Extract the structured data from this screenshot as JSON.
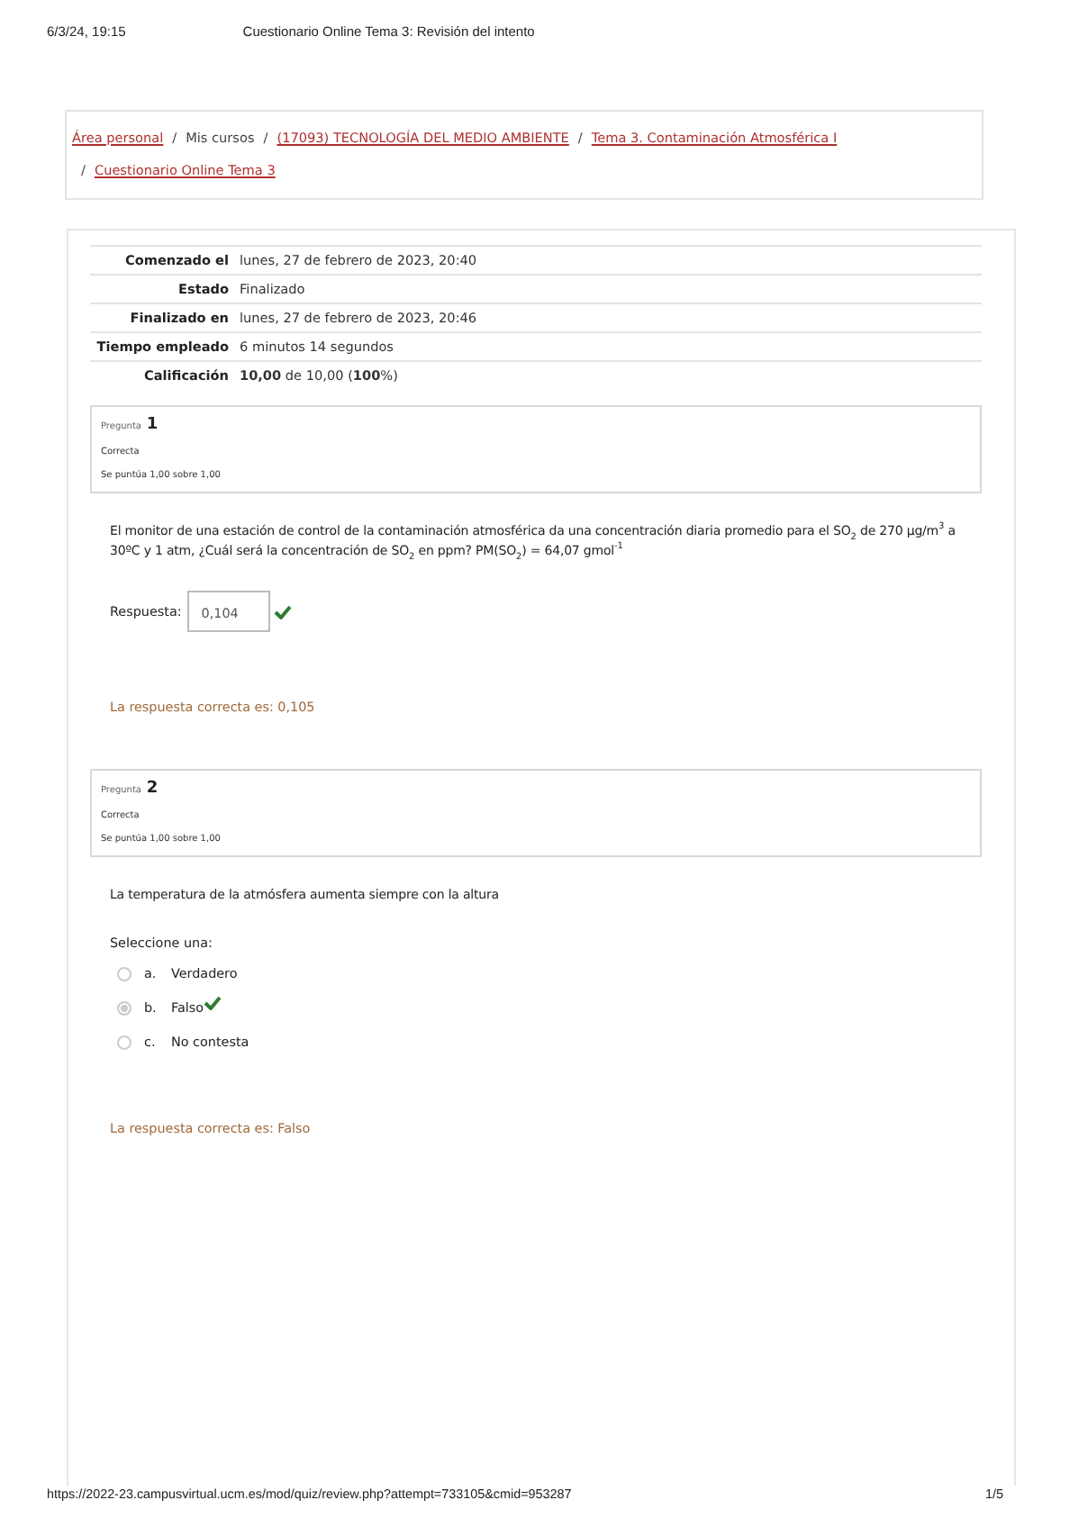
{
  "print_header": {
    "date": "6/3/24, 19:15",
    "title": "Cuestionario Online Tema 3: Revisión del intento"
  },
  "breadcrumb": [
    {
      "label": "Área personal",
      "link": true
    },
    {
      "separator": "/",
      "label": "Mis cursos",
      "link": false
    },
    {
      "separator": "/",
      "label": "(17093) TECNOLOGÍA DEL MEDIO AMBIENTE",
      "link": true
    },
    {
      "separator": "/",
      "label": "Tema 3. Contaminación Atmosférica I",
      "link": true
    },
    {
      "separator": "/",
      "label": "Cuestionario Online Tema 3",
      "link": true
    }
  ],
  "summary": [
    {
      "label": "Comenzado el",
      "value": "lunes, 27 de febrero de 2023, 20:40"
    },
    {
      "label": "Estado",
      "value": "Finalizado"
    },
    {
      "label": "Finalizado en",
      "value": "lunes, 27 de febrero de 2023, 20:46"
    },
    {
      "label": "Tiempo empleado",
      "value": "6 minutos 14 segundos"
    },
    {
      "label": "Calificación",
      "value": "**10,00** de 10,00 (**100**%)"
    }
  ],
  "questions": [
    {
      "kind": "numeric",
      "label": "Pregunta",
      "number": "1",
      "status": "Correcta",
      "score": "Se puntúa 1,00 sobre 1,00",
      "text": "El monitor de una estación de control de la contaminación atmosférica da una concentración diaria promedio para el SO$_{2}$ de 270 µg/m$^{3}$ a 30ºC y 1 atm, ¿Cuál será la concentración de SO$_{2}$ en ppm? PM(SO$_{2}$) = 64,07 gmol$^{-1}$",
      "answer_label": "Respuesta:",
      "answer": "0,104",
      "correct": true,
      "feedback": "La respuesta correcta es: 0,105"
    },
    {
      "kind": "choice",
      "label": "Pregunta",
      "number": "2",
      "status": "Correcta",
      "score": "Se puntúa 1,00 sobre 1,00",
      "text": "La temperatura de la atmósfera aumenta siempre con la altura",
      "prompt": "Seleccione una:",
      "options": [
        {
          "letter": "a.",
          "label": "Verdadero",
          "selected": false,
          "correct": false
        },
        {
          "letter": "b.",
          "label": "Falso",
          "selected": true,
          "correct": true
        },
        {
          "letter": "c.",
          "label": "No contesta",
          "selected": false,
          "correct": false
        }
      ],
      "feedback": "La respuesta correcta es: Falso"
    }
  ],
  "print_footer": {
    "url": "https://2022-23.campusvirtual.ucm.es/mod/quiz/review.php?attempt=733105&cmid=953287",
    "page": "1/5"
  }
}
